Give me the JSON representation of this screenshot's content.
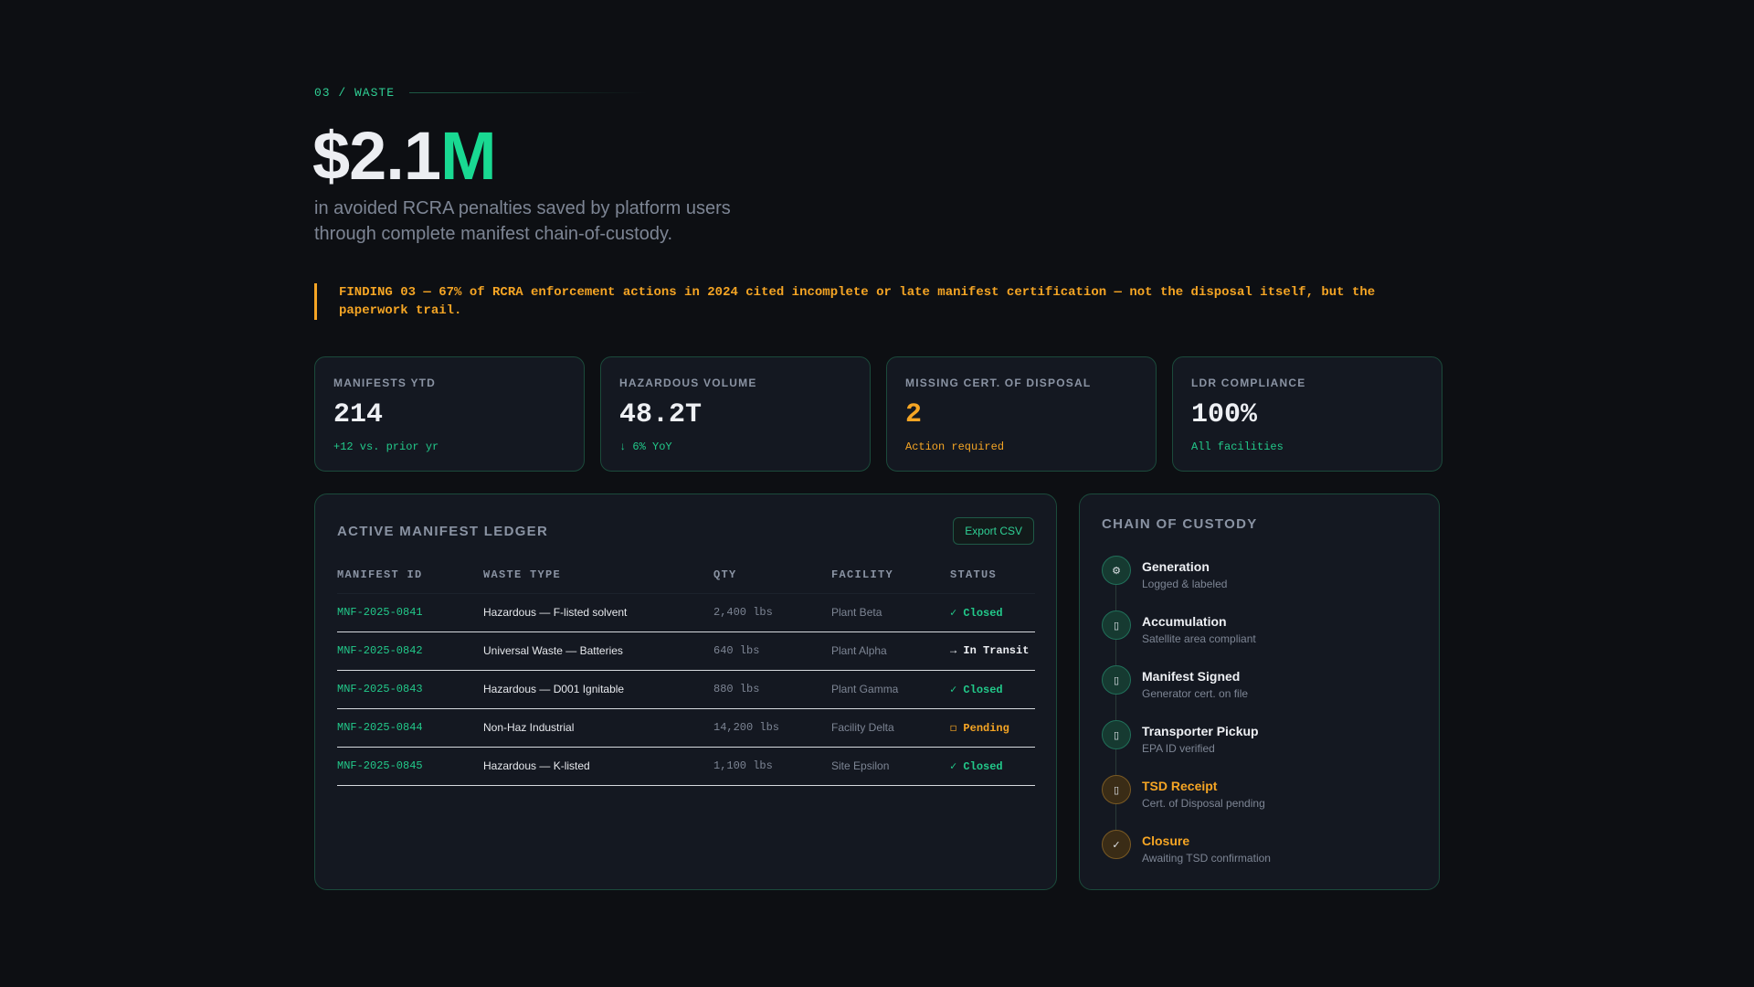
{
  "section": {
    "eyebrow": "03 / WASTE"
  },
  "hero": {
    "value_main": "$2.1",
    "value_accent": "M",
    "subtitle_line1": "in avoided RCRA penalties saved by platform users",
    "subtitle_line2": "through complete manifest chain-of-custody."
  },
  "finding": {
    "text": "FINDING 03 — 67% of RCRA enforcement actions in 2024 cited incomplete or late manifest certification — not the disposal itself, but the paperwork trail."
  },
  "stats": [
    {
      "label": "MANIFESTS YTD",
      "value": "214",
      "note": "+12 vs. prior yr",
      "tone": "normal"
    },
    {
      "label": "HAZARDOUS VOLUME",
      "value": "48.2T",
      "note": "↓ 6% YoY",
      "tone": "normal"
    },
    {
      "label": "MISSING CERT. OF DISPOSAL",
      "value": "2",
      "note": "Action required",
      "tone": "warn"
    },
    {
      "label": "LDR COMPLIANCE",
      "value": "100%",
      "note": "All facilities",
      "tone": "normal"
    }
  ],
  "ledger": {
    "title": "ACTIVE MANIFEST LEDGER",
    "export_label": "Export CSV",
    "columns": [
      "MANIFEST ID",
      "WASTE TYPE",
      "QTY",
      "FACILITY",
      "STATUS"
    ],
    "rows": [
      {
        "id": "MNF-2025-0841",
        "type": "Hazardous — F-listed solvent",
        "qty": "2,400 lbs",
        "facility": "Plant Beta",
        "status": "✓ Closed",
        "status_kind": "closed"
      },
      {
        "id": "MNF-2025-0842",
        "type": "Universal Waste — Batteries",
        "qty": "640 lbs",
        "facility": "Plant Alpha",
        "status": "→ In Transit",
        "status_kind": "transit"
      },
      {
        "id": "MNF-2025-0843",
        "type": "Hazardous — D001 Ignitable",
        "qty": "880 lbs",
        "facility": "Plant Gamma",
        "status": "✓ Closed",
        "status_kind": "closed"
      },
      {
        "id": "MNF-2025-0844",
        "type": "Non-Haz Industrial",
        "qty": "14,200 lbs",
        "facility": "Facility Delta",
        "status": "◻ Pending",
        "status_kind": "pending"
      },
      {
        "id": "MNF-2025-0845",
        "type": "Hazardous — K-listed",
        "qty": "1,100 lbs",
        "facility": "Site Epsilon",
        "status": "✓ Closed",
        "status_kind": "closed"
      }
    ]
  },
  "custody": {
    "title": "CHAIN OF CUSTODY",
    "steps": [
      {
        "title": "Generation",
        "sub": "Logged & labeled",
        "icon": "gear-icon",
        "glyph": "⚙",
        "tone": "ok"
      },
      {
        "title": "Accumulation",
        "sub": "Satellite area compliant",
        "icon": "box-icon",
        "glyph": "▯",
        "tone": "ok"
      },
      {
        "title": "Manifest Signed",
        "sub": "Generator cert. on file",
        "icon": "document-icon",
        "glyph": "▯",
        "tone": "ok"
      },
      {
        "title": "Transporter Pickup",
        "sub": "EPA ID verified",
        "icon": "truck-icon",
        "glyph": "▯",
        "tone": "ok"
      },
      {
        "title": "TSD Receipt",
        "sub": "Cert. of Disposal pending",
        "icon": "receipt-icon",
        "glyph": "▯",
        "tone": "warn"
      },
      {
        "title": "Closure",
        "sub": "Awaiting TSD confirmation",
        "icon": "check-icon",
        "glyph": "✓",
        "tone": "warn"
      }
    ]
  }
}
